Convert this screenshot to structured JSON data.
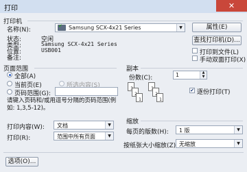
{
  "window": {
    "title": "打印"
  },
  "printer": {
    "group_title": "打印机",
    "name_label": "名称(N):",
    "name_value": "Samsung SCX-4x21 Series",
    "properties_button": "属性(E)",
    "status_label": "状态:",
    "status_value": "空闲",
    "type_label": "类型:",
    "type_value": "Samsung SCX-4x21 Series",
    "where_label": "位置:",
    "where_value": "USB001",
    "comment_label": "备注:",
    "find_printer_button": "查找打印机(D)...",
    "print_to_file_label": "打印到文件(L)",
    "print_to_file_checked": false,
    "manual_duplex_label": "手动双面打印(X)",
    "manual_duplex_checked": false
  },
  "page_range": {
    "group_title": "页面范围",
    "all_label": "全部(A)",
    "current_page_label": "当前页(E)",
    "selection_label": "所选内容(S)",
    "pages_label": "页码范围(G):",
    "pages_value": "",
    "selected": "all",
    "hint": "请键入页码和/或用逗号分隔的页码范围(例如: 1,3,5-12)。"
  },
  "copies": {
    "group_title": "副本",
    "count_label": "份数(C):",
    "count_value": "1",
    "collate_label": "逐份打印(T)",
    "collate_checked": true,
    "page_labels": [
      "1",
      "2",
      "3"
    ]
  },
  "print_what": {
    "label": "打印内容(W):",
    "value": "文档"
  },
  "print": {
    "label": "打印(R):",
    "value": "范围中所有页面"
  },
  "zoom": {
    "group_title": "缩放",
    "pages_per_sheet_label": "每页的版数(H):",
    "pages_per_sheet_value": "1 版",
    "scale_to_paper_label": "按纸张大小缩放(Z):",
    "scale_to_paper_value": "无缩放"
  },
  "footer": {
    "options_button": "选项(O)..."
  }
}
